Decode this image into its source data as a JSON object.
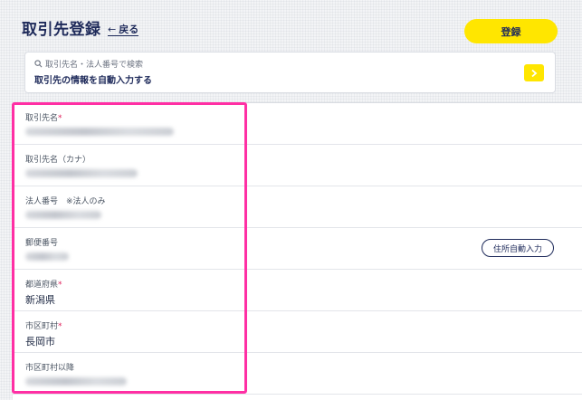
{
  "header": {
    "title": "取引先登録",
    "back_label": "戻る",
    "register_label": "登録"
  },
  "search": {
    "hint": "取引先名・法人番号で検索",
    "title": "取引先の情報を自動入力する",
    "arrow": "›"
  },
  "fields": [
    {
      "label": "取引先名",
      "required": "*",
      "value": ""
    },
    {
      "label": "取引先名（カナ）",
      "required": "",
      "value": ""
    },
    {
      "label": "法人番号　※法人のみ",
      "required": "",
      "value": ""
    },
    {
      "label": "郵便番号",
      "required": "",
      "value": "",
      "button": "住所自動入力"
    },
    {
      "label": "都道府県",
      "required": "*",
      "value": "新潟県"
    },
    {
      "label": "市区町村",
      "required": "*",
      "value": "長岡市"
    },
    {
      "label": "市区町村以降",
      "required": "",
      "value": ""
    }
  ],
  "colors": {
    "accent": "#ffe600",
    "navy": "#1e2a5a",
    "highlight": "#ff2fa4",
    "required": "#e0245e"
  },
  "icons": {
    "search": "search-icon",
    "back": "arrow-left-icon",
    "next": "chevron-right-icon"
  }
}
